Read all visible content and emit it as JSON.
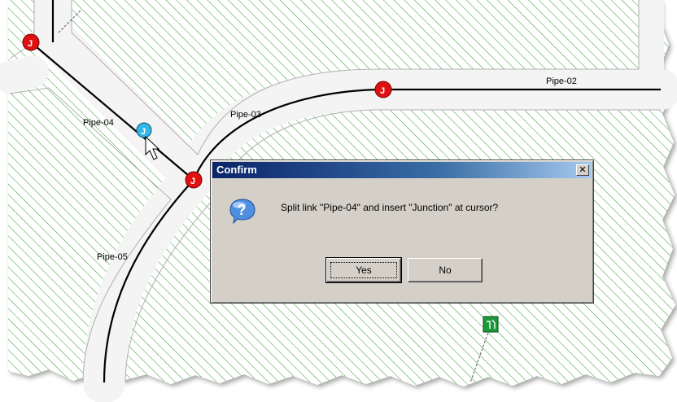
{
  "map": {
    "pipes": [
      {
        "id": "pipe-01",
        "label": ""
      },
      {
        "id": "pipe-02",
        "label": "Pipe-02"
      },
      {
        "id": "pipe-03",
        "label": "Pipe-03"
      },
      {
        "id": "pipe-04",
        "label": "Pipe-04"
      },
      {
        "id": "pipe-05",
        "label": "Pipe-05"
      }
    ],
    "junction_letter": "J",
    "junction_color": "#e01010",
    "selected_junction_color": "#30b8e8",
    "parcel_hatch_color": "#2e9a2e",
    "pipe_color": "#000000",
    "tank_icon": "tank-icon"
  },
  "dialog": {
    "title": "Confirm",
    "close_glyph": "✕",
    "icon": "question-icon",
    "message": "Split link \"Pipe-04\" and insert \"Junction\" at cursor?",
    "yes_label": "Yes",
    "no_label": "No"
  }
}
